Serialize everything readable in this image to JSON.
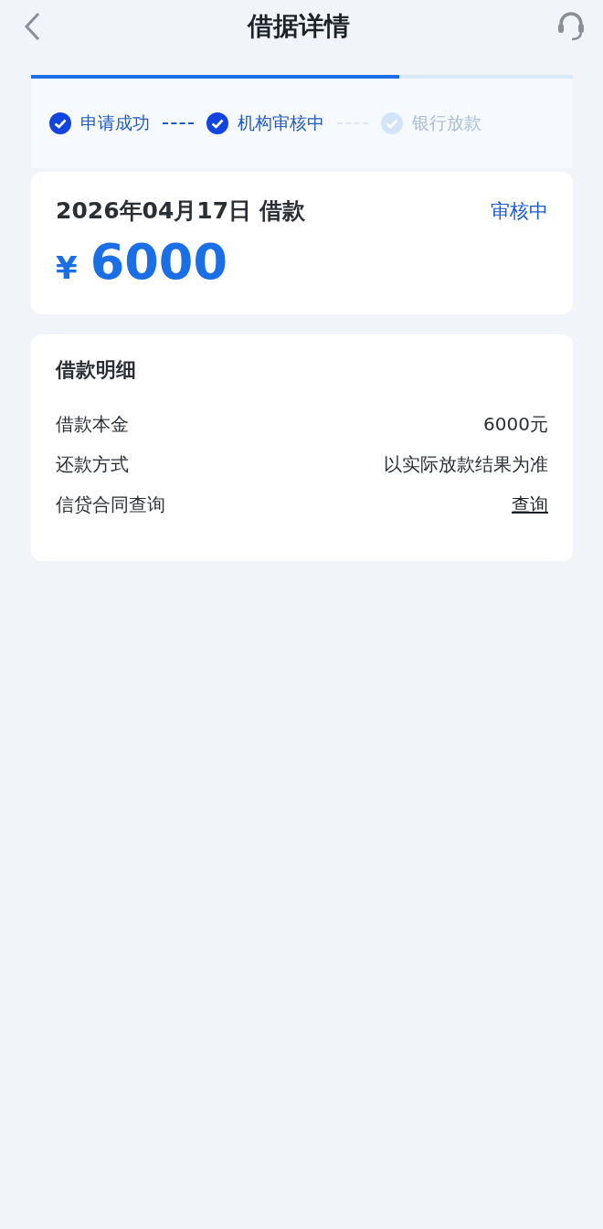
{
  "header": {
    "title": "借据详情"
  },
  "progress": {
    "level": 0.68
  },
  "steps": [
    {
      "label": "申请成功",
      "done": true
    },
    {
      "label": "机构审核中",
      "done": true
    },
    {
      "label": "银行放款",
      "done": false
    }
  ],
  "loan": {
    "date": "2026年04月17日 借款",
    "status": "审核中",
    "currency": "¥",
    "amount": "6000"
  },
  "details": {
    "title": "借款明细",
    "rows": [
      {
        "label": "借款本金",
        "value": "6000元",
        "kind": "text"
      },
      {
        "label": "还款方式",
        "value": "以实际放款结果为准",
        "kind": "text"
      },
      {
        "label": "信贷合同查询",
        "value": "查询",
        "kind": "link"
      }
    ]
  }
}
